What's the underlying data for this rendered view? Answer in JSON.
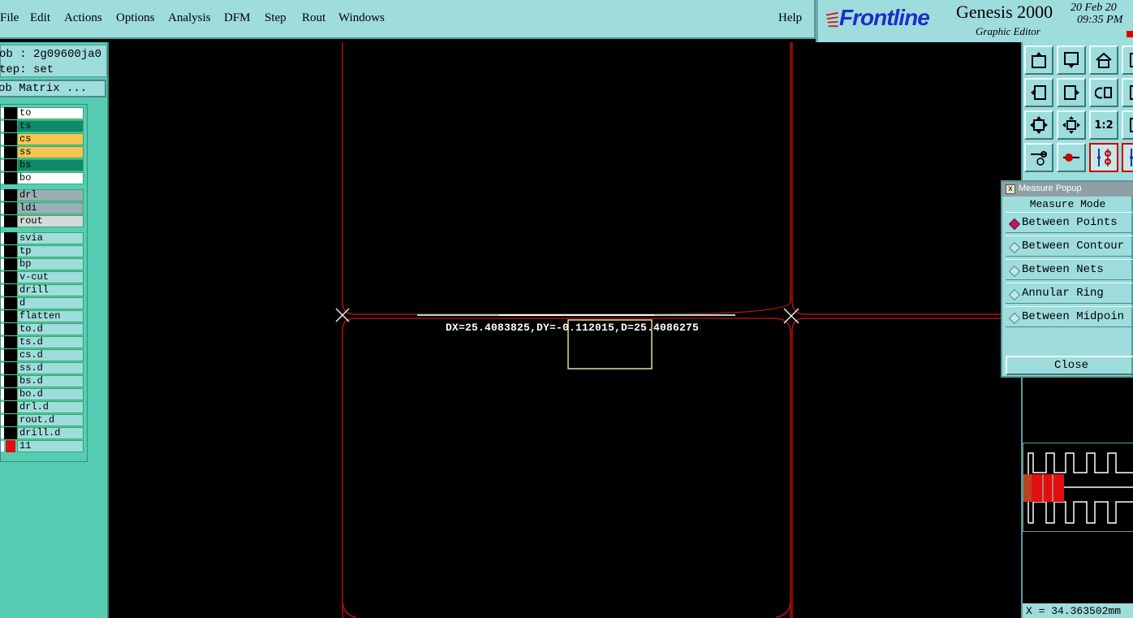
{
  "menu": {
    "items": [
      "File",
      "Edit",
      "Actions",
      "Options",
      "Analysis",
      "DFM",
      "Step",
      "Rout",
      "Windows"
    ],
    "help": "Help"
  },
  "brand": {
    "logo": "Frontline",
    "title": "Genesis 2000",
    "subtitle": "Graphic Editor",
    "date_line1": "20 Feb 20",
    "date_line2": "09:35 PM"
  },
  "job": {
    "name": "ob : 2g09600ja0",
    "step": "tep: set",
    "matrix_button": "ob Matrix ..."
  },
  "layers": [
    {
      "name": "to",
      "color": "#ffffff"
    },
    {
      "name": "ts",
      "color": "#0e8a6a"
    },
    {
      "name": "cs",
      "color": "#f6c453"
    },
    {
      "name": "ss",
      "color": "#f6c453"
    },
    {
      "name": "bs",
      "color": "#0e8a6a"
    },
    {
      "name": "bo",
      "color": "#ffffff"
    },
    {
      "name": "drl",
      "color": "#9aaeb8"
    },
    {
      "name": "ldi",
      "color": "#9aaeb8"
    },
    {
      "name": "rout",
      "color": "#d8d8d8"
    },
    {
      "name": "svia",
      "color": "#9fdcdc"
    },
    {
      "name": "tp",
      "color": "#9fdcdc"
    },
    {
      "name": "bp",
      "color": "#9fdcdc"
    },
    {
      "name": "v-cut",
      "color": "#9fdcdc"
    },
    {
      "name": "drill",
      "color": "#9fdcdc"
    },
    {
      "name": "d",
      "color": "#9fdcdc"
    },
    {
      "name": "flatten",
      "color": "#9fdcdc"
    },
    {
      "name": "to.d",
      "color": "#9fdcdc"
    },
    {
      "name": "ts.d",
      "color": "#9fdcdc"
    },
    {
      "name": "cs.d",
      "color": "#9fdcdc"
    },
    {
      "name": "ss.d",
      "color": "#9fdcdc"
    },
    {
      "name": "bs.d",
      "color": "#9fdcdc"
    },
    {
      "name": "bo.d",
      "color": "#9fdcdc"
    },
    {
      "name": "drl.d",
      "color": "#9fdcdc"
    },
    {
      "name": "rout.d",
      "color": "#9fdcdc"
    },
    {
      "name": "drill.d",
      "color": "#9fdcdc"
    },
    {
      "name": "11",
      "color": "#9fdcdc"
    }
  ],
  "canvas": {
    "measure_readout": "DX=25.4083825,DY=-0.112015,D=25.4086275",
    "outline_color": "#d01010",
    "highlight_color": "#ffffb0"
  },
  "toolbar": {
    "icons": [
      "page-up-icon",
      "page-down-icon",
      "home-icon",
      "frame-icon",
      "prev-icon",
      "next-icon",
      "undo-icon",
      "expand-icon",
      "fit-icon",
      "center-icon",
      "ratio-icon",
      "zoom-icon",
      "tools-icon",
      "pad-icon",
      "netlist-icon",
      "netlist2-icon"
    ],
    "ratio_label": "1:2"
  },
  "measure_popup": {
    "title": "Measure Popup",
    "heading": "Measure Mode",
    "options": [
      "Between Points",
      "Between Contour",
      "Between Nets",
      "Annular Ring",
      "Between Midpoin"
    ],
    "selected": 0,
    "close": "Close"
  },
  "status": {
    "coord": "X = 34.363502mm"
  }
}
